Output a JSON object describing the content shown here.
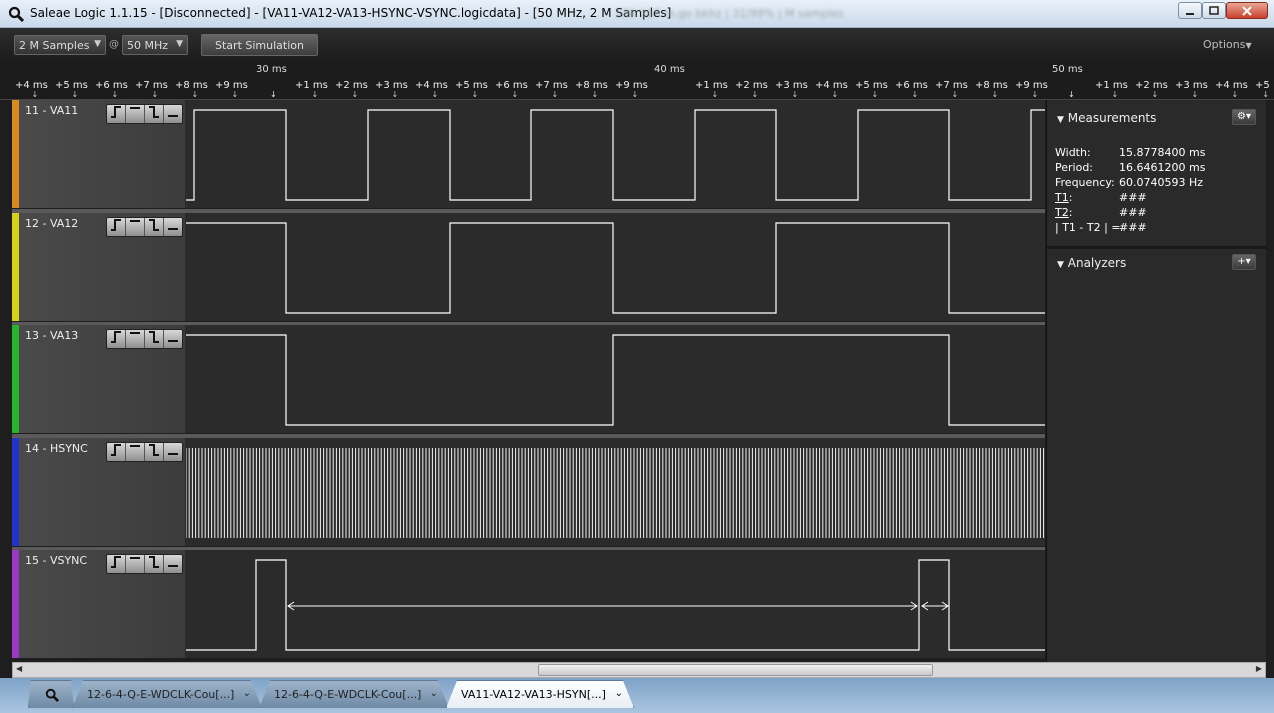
{
  "window": {
    "title": "Saleae Logic 1.1.15 - [Disconnected] - [VA11-VA12-VA13-HSYNC-VSYNC.logicdata] - [50 MHz, 2 M Samples]",
    "title_extra": "186 167 m.go bkhz  | 31/99%  | M samples"
  },
  "toolbar": {
    "samples": "2 M Samples",
    "at": "@",
    "frequency": "50 MHz",
    "start_simulation": "Start Simulation",
    "options": "Options"
  },
  "ruler": {
    "ticks": [
      "+4 ms",
      "+5 ms",
      "+6 ms",
      "+7 ms",
      "+8 ms",
      "+9 ms",
      "+1 ms",
      "+2 ms",
      "+3 ms",
      "+4 ms",
      "+5 ms",
      "+6 ms",
      "+7 ms",
      "+8 ms",
      "+9 ms",
      "+1 ms",
      "+2 ms",
      "+3 ms",
      "+4 ms",
      "+5 ms",
      "+6 ms",
      "+7 ms",
      "+8 ms",
      "+9 ms",
      "+1 ms",
      "+2 ms",
      "+3 ms",
      "+4 ms",
      "+5"
    ],
    "majors": [
      "30 ms",
      "40 ms",
      "50 ms"
    ]
  },
  "channels": [
    {
      "name": "11 - VA11",
      "color": "#d98a1f"
    },
    {
      "name": "12 - VA12",
      "color": "#d6d21a"
    },
    {
      "name": "13 - VA13",
      "color": "#27b52e"
    },
    {
      "name": "14 - HSYNC",
      "color": "#2233cc"
    },
    {
      "name": "15 - VSYNC",
      "color": "#9b39c7"
    }
  ],
  "trigger_icons": [
    "rising-edge-icon",
    "high-level-icon",
    "falling-edge-icon",
    "low-level-icon"
  ],
  "measurements": {
    "header": "Measurements",
    "width_label": "Width:",
    "width_value": "15.8778400 ms",
    "period_label": "Period:",
    "period_value": "16.6461200 ms",
    "frequency_label": "Frequency:",
    "frequency_value": "60.0740593 Hz",
    "t1_label": "T1",
    "t1_value": "###",
    "t2_label": "T2",
    "t2_value": "###",
    "diff_label": "| T1 - T2 | =",
    "diff_value": "###"
  },
  "analyzers": {
    "header": "Analyzers"
  },
  "tabs": [
    {
      "label": "12-6-4-Q-E-WDCLK-Cou[...]"
    },
    {
      "label": "12-6-4-Q-E-WDCLK-Cou[...]"
    },
    {
      "label": "VA11-VA12-VA13-HSYN[...]"
    }
  ]
}
